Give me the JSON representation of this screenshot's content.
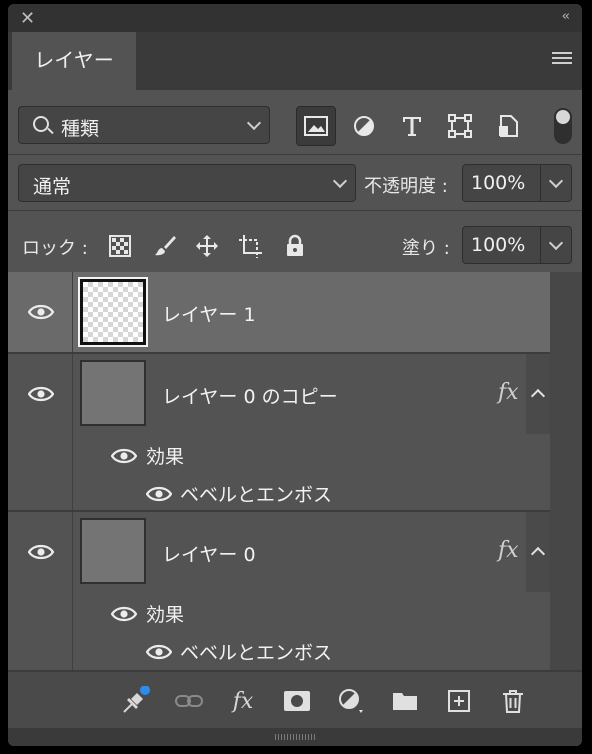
{
  "window": {
    "close_icon": "close-icon",
    "collapse_label": "‹‹"
  },
  "tab": {
    "label": "レイヤー"
  },
  "filter": {
    "kind_label": "種類",
    "icons": [
      "image-filter-icon",
      "adjustment-filter-icon",
      "type-filter-icon",
      "shape-filter-icon",
      "smart-object-filter-icon"
    ]
  },
  "blend": {
    "mode": "通常",
    "opacity_label": "不透明度 :",
    "opacity_value": "100%"
  },
  "lock": {
    "label": "ロック :",
    "fill_label": "塗り :",
    "fill_value": "100%"
  },
  "layers": [
    {
      "name": "レイヤー 1",
      "selected": true,
      "thumbnail": "transparent"
    },
    {
      "name": "レイヤー 0 のコピー",
      "fx": "fx",
      "effects_label": "効果",
      "effect": "ベベルとエンボス"
    },
    {
      "name": "レイヤー 0",
      "fx": "fx",
      "effects_label": "効果",
      "effect": "ベベルとエンボス"
    }
  ],
  "colors": {
    "panel": "#535353",
    "selected_row": "#6a6a6a",
    "badge": "#2d8ceb"
  }
}
